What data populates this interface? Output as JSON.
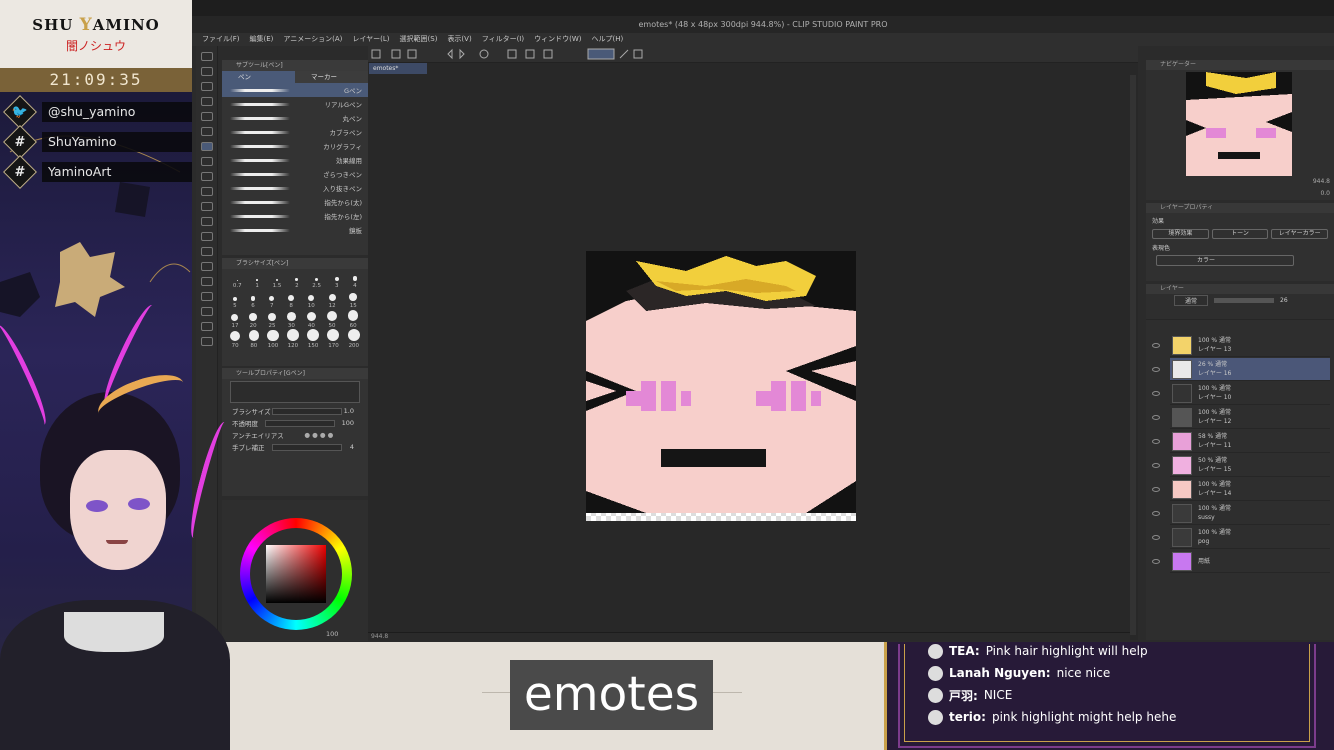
{
  "stream": {
    "brand_name_1": "SHU ",
    "brand_name_y": "Y",
    "brand_name_2": "AMINO",
    "brand_jp": "闇ノシュウ",
    "clock": "21:09:35",
    "socials": [
      {
        "icon": "twitter-bird-icon",
        "text": "@shu_yamino"
      },
      {
        "icon": "hashtag-icon",
        "text": "ShuYamino"
      },
      {
        "icon": "hashtag-icon",
        "text": "YaminoArt"
      }
    ],
    "caption": "emotes"
  },
  "app": {
    "title": "emotes* (48 x 48px 300dpi 944.8%) - CLIP STUDIO PAINT PRO",
    "menu": [
      "ファイル(F)",
      "編集(E)",
      "アニメーション(A)",
      "レイヤー(L)",
      "選択範囲(S)",
      "表示(V)",
      "フィルター(I)",
      "ウィンドウ(W)",
      "ヘルプ(H)"
    ],
    "doc_tab": "emotes*",
    "status_zoom": "944.8",
    "subtool": {
      "title": "サブツール[ペン]",
      "tabs": [
        "ペン",
        "マーカー"
      ],
      "brushes": [
        "Gペン",
        "リアルGペン",
        "丸ペン",
        "カブラペン",
        "カリグラフィ",
        "効果線用",
        "ざらつきペン",
        "入り抜きペン",
        "指先から(太)",
        "指先から(左)",
        "鏡板"
      ]
    },
    "brush_size": {
      "title": "ブラシサイズ[ペン]",
      "rows": [
        [
          "0.7",
          "1",
          "1.5",
          "2",
          "2.5",
          "3",
          "4"
        ],
        [
          "5",
          "6",
          "7",
          "8",
          "10",
          "12",
          "15"
        ],
        [
          "17",
          "20",
          "25",
          "30",
          "40",
          "50",
          "60"
        ],
        [
          "70",
          "80",
          "100",
          "120",
          "150",
          "170",
          "200"
        ]
      ]
    },
    "tool_property": {
      "title": "ツールプロパティ[Gペン]",
      "rows": [
        {
          "label": "ブラシサイズ",
          "value": "1.0"
        },
        {
          "label": "不透明度",
          "value": "100"
        },
        {
          "label": "アンチエイリアス",
          "value": ""
        },
        {
          "label": "手ブレ補正",
          "value": "4"
        }
      ]
    },
    "color_opacity": "100",
    "layer_property": {
      "title": "レイヤープロパティ",
      "label_effect": "効果",
      "effect_buttons": [
        "境界効果",
        "トーン",
        "レイヤーカラー"
      ],
      "label_color": "表現色",
      "color_select": "カラー"
    },
    "layers": [
      {
        "top": "100 % 通常",
        "name": "レイヤー 13",
        "thumb": "#f3d36a",
        "selected": false
      },
      {
        "top": "26 % 通常",
        "name": "レイヤー 16",
        "thumb": "#e9e9e9",
        "selected": true
      },
      {
        "top": "100 % 通常",
        "name": "レイヤー 10",
        "thumb": "#333333",
        "selected": false
      },
      {
        "top": "100 % 通常",
        "name": "レイヤー 12",
        "thumb": "#555555",
        "selected": false
      },
      {
        "top": "58 % 通常",
        "name": "レイヤー 11",
        "thumb": "#e8a0d8",
        "selected": false
      },
      {
        "top": "50 % 通常",
        "name": "レイヤー 15",
        "thumb": "#f0b0e0",
        "selected": false
      },
      {
        "top": "100 % 通常",
        "name": "レイヤー 14",
        "thumb": "#f6c9c4",
        "selected": false
      },
      {
        "top": "100 % 通常",
        "name": "sussy",
        "thumb": "#3a3a3a",
        "selected": false
      },
      {
        "top": "100 % 通常",
        "name": "pog",
        "thumb": "#3a3a3a",
        "selected": false
      },
      {
        "top": "",
        "name": "用紙",
        "thumb": "#c878f0",
        "selected": false
      }
    ],
    "layer_blend": "通常",
    "layer_opacity": "26",
    "nav_zoom": "944.8",
    "nav_rotate": "0.0"
  },
  "chat": [
    {
      "user": "TEA:",
      "text": "Pink hair highlight will help"
    },
    {
      "user": "Lanah Nguyen:",
      "text": "nice nice"
    },
    {
      "user": "戸羽:",
      "text": "NICE"
    },
    {
      "user": "terio:",
      "text": "pink highlight might help hehe"
    }
  ]
}
